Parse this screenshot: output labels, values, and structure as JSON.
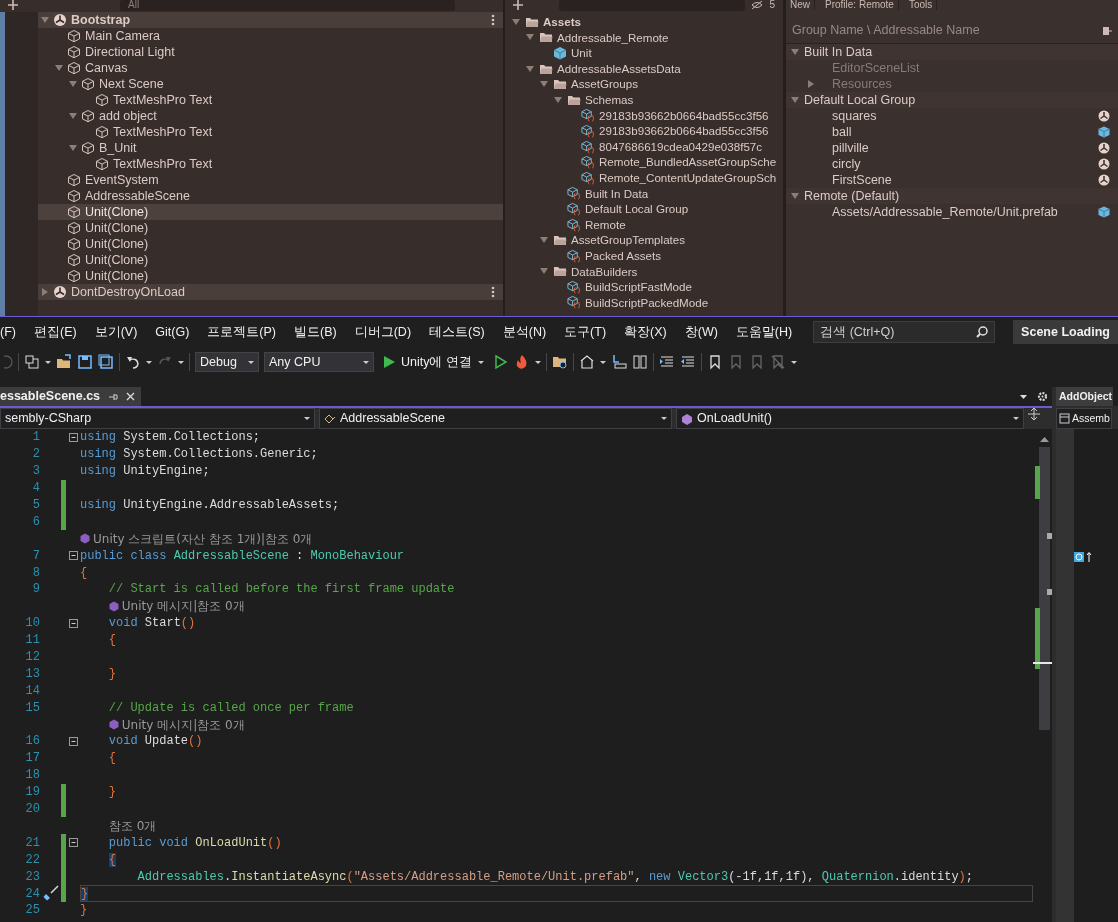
{
  "hierarchy": {
    "search": {
      "placeholder": "All"
    },
    "items": [
      {
        "label": "Bootstrap",
        "kind": "scene",
        "expanded": true,
        "selected": false,
        "children": [
          {
            "label": "Main Camera",
            "kind": "object",
            "selected": false
          },
          {
            "label": "Directional Light",
            "kind": "object",
            "selected": false
          },
          {
            "label": "Canvas",
            "kind": "object",
            "expanded": true,
            "selected": false,
            "children": [
              {
                "label": "Next Scene",
                "kind": "object",
                "expanded": true,
                "selected": false,
                "children": [
                  {
                    "label": "TextMeshPro Text",
                    "kind": "object",
                    "selected": false
                  }
                ]
              },
              {
                "label": "add object",
                "kind": "object",
                "expanded": true,
                "selected": false,
                "children": [
                  {
                    "label": "TextMeshPro Text",
                    "kind": "object",
                    "selected": false
                  }
                ]
              },
              {
                "label": "B_Unit",
                "kind": "object",
                "expanded": true,
                "selected": false,
                "children": [
                  {
                    "label": "TextMeshPro Text",
                    "kind": "object",
                    "selected": false
                  }
                ]
              }
            ]
          },
          {
            "label": "EventSystem",
            "kind": "object",
            "selected": false
          },
          {
            "label": "AddressableScene",
            "kind": "object",
            "selected": false
          },
          {
            "label": "Unit(Clone)",
            "kind": "object",
            "selected": true
          },
          {
            "label": "Unit(Clone)",
            "kind": "object",
            "selected": false
          },
          {
            "label": "Unit(Clone)",
            "kind": "object",
            "selected": false
          },
          {
            "label": "Unit(Clone)",
            "kind": "object",
            "selected": false
          },
          {
            "label": "Unit(Clone)",
            "kind": "object",
            "selected": false
          }
        ]
      },
      {
        "label": "DontDestroyOnLoad",
        "kind": "scene",
        "expanded": false,
        "selected": false
      }
    ]
  },
  "project": {
    "hidden_count": "5",
    "items": [
      {
        "label": "Assets",
        "kind": "folder",
        "expanded": true,
        "children": [
          {
            "label": "Addressable_Remote",
            "kind": "folder",
            "expanded": true,
            "children": [
              {
                "label": "Unit",
                "kind": "prefab"
              }
            ]
          },
          {
            "label": "AddressableAssetsData",
            "kind": "folder",
            "expanded": true,
            "children": [
              {
                "label": "AssetGroups",
                "kind": "folder",
                "expanded": true,
                "children": [
                  {
                    "label": "Schemas",
                    "kind": "folder",
                    "expanded": true,
                    "children": [
                      {
                        "label": "29183b93662b0664bad55cc3f56",
                        "kind": "asset"
                      },
                      {
                        "label": "29183b93662b0664bad55cc3f56",
                        "kind": "asset"
                      },
                      {
                        "label": "8047686619cdea0429e038f57c",
                        "kind": "asset"
                      },
                      {
                        "label": "Remote_BundledAssetGroupSche",
                        "kind": "asset"
                      },
                      {
                        "label": "Remote_ContentUpdateGroupSch",
                        "kind": "asset"
                      }
                    ]
                  },
                  {
                    "label": "Built In Data",
                    "kind": "asset"
                  },
                  {
                    "label": "Default Local Group",
                    "kind": "asset"
                  },
                  {
                    "label": "Remote",
                    "kind": "asset"
                  }
                ]
              },
              {
                "label": "AssetGroupTemplates",
                "kind": "folder",
                "expanded": true,
                "children": [
                  {
                    "label": "Packed Assets",
                    "kind": "asset"
                  }
                ]
              },
              {
                "label": "DataBuilders",
                "kind": "folder",
                "expanded": true,
                "children": [
                  {
                    "label": "BuildScriptFastMode",
                    "kind": "asset"
                  },
                  {
                    "label": "BuildScriptPackedMode",
                    "kind": "asset"
                  }
                ]
              }
            ]
          }
        ]
      }
    ]
  },
  "addressables": {
    "toolbar": [
      "New",
      "Profile: Remote",
      "Tools"
    ],
    "header": "Group Name \\ Addressable Name",
    "groups": [
      {
        "name": "Built In Data",
        "expanded": true,
        "entries": [
          {
            "name": "EditorSceneList",
            "kind": "none",
            "disabled": true
          },
          {
            "name": "Resources",
            "kind": "none",
            "disabled": true,
            "expanded": false
          }
        ]
      },
      {
        "name": "Default Local Group",
        "expanded": true,
        "entries": [
          {
            "name": "squares",
            "kind": "scene",
            "disabled": false
          },
          {
            "name": "ball",
            "kind": "prefab",
            "disabled": false
          },
          {
            "name": "pillville",
            "kind": "scene",
            "disabled": false
          },
          {
            "name": "circly",
            "kind": "scene",
            "disabled": false
          },
          {
            "name": "FirstScene",
            "kind": "scene",
            "disabled": false
          }
        ]
      },
      {
        "name": "Remote (Default)",
        "expanded": true,
        "entries": [
          {
            "name": "Assets/Addressable_Remote/Unit.prefab",
            "kind": "prefab",
            "disabled": false
          }
        ]
      }
    ]
  },
  "vs": {
    "menu": [
      "(F)",
      "편집(E)",
      "보기(V)",
      "Git(G)",
      "프로젝트(P)",
      "빌드(B)",
      "디버그(D)",
      "테스트(S)",
      "분석(N)",
      "도구(T)",
      "확장(X)",
      "창(W)",
      "도움말(H)"
    ],
    "search": {
      "placeholder": "검색 (Ctrl+Q)"
    },
    "title_button": "Scene Loading",
    "toolbar": {
      "configuration": "Debug",
      "platform": "Any CPU",
      "run": "Unity에 연결"
    },
    "tabs": [
      {
        "label": "essableScene.cs",
        "selected": true
      }
    ],
    "side_tab": "AddObject",
    "nav": [
      "sembly-CSharp",
      "AddressableScene",
      "OnLoadUnit()"
    ],
    "side_nav": "Assemb",
    "lines": [
      {
        "kind": "code",
        "number": "1",
        "changed": false,
        "foldable": true,
        "current": false,
        "tokens": [
          {
            "text": "using ",
            "kind": "kw"
          },
          {
            "text": "System.Collections;",
            "kind": "plain"
          }
        ]
      },
      {
        "kind": "code",
        "number": "2",
        "changed": false,
        "foldable": false,
        "current": false,
        "tokens": [
          {
            "text": "using ",
            "kind": "kw"
          },
          {
            "text": "System.Collections.Generic;",
            "kind": "plain"
          }
        ]
      },
      {
        "kind": "code",
        "number": "3",
        "changed": false,
        "foldable": false,
        "current": false,
        "tokens": [
          {
            "text": "using ",
            "kind": "kw"
          },
          {
            "text": "UnityEngine;",
            "kind": "plain"
          }
        ]
      },
      {
        "kind": "code",
        "number": "4",
        "changed": true,
        "foldable": false,
        "current": false
      },
      {
        "kind": "code",
        "number": "5",
        "changed": true,
        "foldable": false,
        "current": false,
        "tokens": [
          {
            "text": "using ",
            "kind": "kw"
          },
          {
            "text": "UnityEngine.AddressableAssets;",
            "kind": "plain"
          }
        ]
      },
      {
        "kind": "code",
        "number": "6",
        "changed": true,
        "foldable": false,
        "current": false
      },
      {
        "kind": "lens",
        "icon": true,
        "text": "Unity 스크립트(자산 참조 1개)|참조 0개"
      },
      {
        "kind": "code",
        "number": "7",
        "changed": false,
        "foldable": true,
        "current": false,
        "tokens": [
          {
            "text": "public class ",
            "kind": "kw"
          },
          {
            "text": "AddressableScene",
            "kind": "type"
          },
          {
            "text": " : ",
            "kind": "plain"
          },
          {
            "text": "MonoBehaviour",
            "kind": "type"
          }
        ]
      },
      {
        "kind": "code",
        "number": "8",
        "changed": false,
        "foldable": false,
        "current": false,
        "tokens": [
          {
            "text": "{",
            "kind": "punct"
          }
        ]
      },
      {
        "kind": "code",
        "number": "9",
        "changed": false,
        "foldable": false,
        "current": false,
        "tokens": [
          {
            "text": "    // Start is called before the first frame update",
            "kind": "comment"
          }
        ]
      },
      {
        "kind": "lens",
        "icon": true,
        "text": "    Unity 메시지|참조 0개"
      },
      {
        "kind": "code",
        "number": "10",
        "changed": false,
        "foldable": true,
        "current": false,
        "tokens": [
          {
            "text": "    void ",
            "kind": "kw"
          },
          {
            "text": "Start",
            "kind": "plain"
          },
          {
            "text": "()",
            "kind": "punct"
          }
        ]
      },
      {
        "kind": "code",
        "number": "11",
        "changed": false,
        "foldable": false,
        "current": false,
        "tokens": [
          {
            "text": "    {",
            "kind": "punct"
          }
        ]
      },
      {
        "kind": "code",
        "number": "12",
        "changed": false,
        "foldable": false,
        "current": false
      },
      {
        "kind": "code",
        "number": "13",
        "changed": false,
        "foldable": false,
        "current": false,
        "tokens": [
          {
            "text": "    }",
            "kind": "punct"
          }
        ]
      },
      {
        "kind": "code",
        "number": "14",
        "changed": false,
        "foldable": false,
        "current": false
      },
      {
        "kind": "code",
        "number": "15",
        "changed": false,
        "foldable": false,
        "current": false,
        "tokens": [
          {
            "text": "    // Update is called once per frame",
            "kind": "comment"
          }
        ]
      },
      {
        "kind": "lens",
        "icon": true,
        "text": "    Unity 메시지|참조 0개"
      },
      {
        "kind": "code",
        "number": "16",
        "changed": false,
        "foldable": true,
        "current": false,
        "tokens": [
          {
            "text": "    void ",
            "kind": "kw"
          },
          {
            "text": "Update",
            "kind": "plain"
          },
          {
            "text": "()",
            "kind": "punct"
          }
        ]
      },
      {
        "kind": "code",
        "number": "17",
        "changed": false,
        "foldable": false,
        "current": false,
        "tokens": [
          {
            "text": "    {",
            "kind": "punct"
          }
        ]
      },
      {
        "kind": "code",
        "number": "18",
        "changed": false,
        "foldable": false,
        "current": false
      },
      {
        "kind": "code",
        "number": "19",
        "changed": true,
        "foldable": false,
        "current": false,
        "tokens": [
          {
            "text": "    }",
            "kind": "punct"
          }
        ]
      },
      {
        "kind": "code",
        "number": "20",
        "changed": true,
        "foldable": false,
        "current": false
      },
      {
        "kind": "lens",
        "icon": false,
        "text": "    참조 0개"
      },
      {
        "kind": "code",
        "number": "21",
        "changed": true,
        "foldable": true,
        "current": false,
        "tokens": [
          {
            "text": "    public void ",
            "kind": "kw"
          },
          {
            "text": "OnLoadUnit",
            "kind": "method"
          },
          {
            "text": "()",
            "kind": "punct"
          }
        ]
      },
      {
        "kind": "code",
        "number": "22",
        "changed": true,
        "foldable": false,
        "current": false,
        "tokens": [
          {
            "text": "    {",
            "kind": "match"
          }
        ]
      },
      {
        "kind": "code",
        "number": "23",
        "changed": true,
        "foldable": false,
        "current": false,
        "tokens": [
          {
            "text": "        Addressables",
            "kind": "type"
          },
          {
            "text": ".",
            "kind": "plain"
          },
          {
            "text": "InstantiateAsync",
            "kind": "method"
          },
          {
            "text": "(",
            "kind": "punct"
          },
          {
            "text": "\"Assets/Addressable_Remote/Unit.prefab\"",
            "kind": "string"
          },
          {
            "text": ", ",
            "kind": "plain"
          },
          {
            "text": "new ",
            "kind": "kw"
          },
          {
            "text": "Vector3",
            "kind": "type"
          },
          {
            "text": "(-1f,1f,1f), ",
            "kind": "plain"
          },
          {
            "text": "Quaternion",
            "kind": "type"
          },
          {
            "text": ".identity",
            "kind": "plain"
          },
          {
            "text": ")",
            "kind": "punct"
          },
          {
            "text": ";",
            "kind": "plain"
          }
        ]
      },
      {
        "kind": "code",
        "number": "24",
        "changed": true,
        "foldable": false,
        "current": true,
        "tokens": [
          {
            "text": "    }",
            "kind": "match"
          }
        ]
      },
      {
        "kind": "code",
        "number": "25",
        "changed": false,
        "foldable": false,
        "current": false,
        "tokens": [
          {
            "text": "}",
            "kind": "punct"
          }
        ]
      }
    ]
  }
}
